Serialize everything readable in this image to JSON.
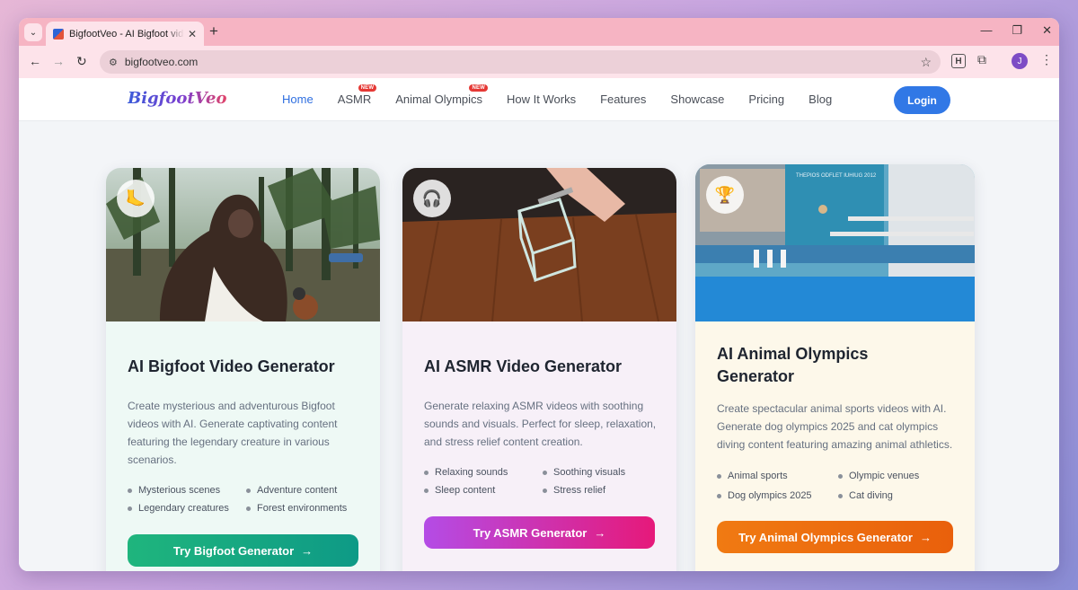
{
  "browser": {
    "tab_title": "BigfootVeo - AI Bigfoot video G",
    "url": "bigfootveo.com",
    "profile_initial": "J",
    "extension_label": "H"
  },
  "site": {
    "logo": "BigfootVeo",
    "nav": [
      {
        "label": "Home",
        "active": true
      },
      {
        "label": "ASMR",
        "badge": "NEW"
      },
      {
        "label": "Animal Olympics",
        "badge": "NEW"
      },
      {
        "label": "How It Works"
      },
      {
        "label": "Features"
      },
      {
        "label": "Showcase"
      },
      {
        "label": "Pricing"
      },
      {
        "label": "Blog"
      }
    ],
    "login_label": "Login"
  },
  "cards": [
    {
      "icon": "🦶",
      "title": "AI Bigfoot Video Generator",
      "description": "Create mysterious and adventurous Bigfoot videos with AI. Generate captivating content featuring the legendary creature in various scenarios.",
      "features": [
        "Mysterious scenes",
        "Adventure content",
        "Legendary creatures",
        "Forest environments"
      ],
      "cta": "Try Bigfoot Generator",
      "cta_colors": [
        "#1fb57d",
        "#0e9a86"
      ]
    },
    {
      "icon": "🎧",
      "title": "AI ASMR Video Generator",
      "description": "Generate relaxing ASMR videos with soothing sounds and visuals. Perfect for sleep, relaxation, and stress relief content creation.",
      "features": [
        "Relaxing sounds",
        "Soothing visuals",
        "Sleep content",
        "Stress relief"
      ],
      "cta": "Try ASMR Generator",
      "cta_colors": [
        "#b44ce6",
        "#e6197a"
      ]
    },
    {
      "icon": "🏆",
      "title": "AI Animal Olympics Generator",
      "description": "Create spectacular animal sports videos with AI. Generate dog olympics 2025 and cat olympics diving content featuring amazing animal athletics.",
      "features": [
        "Animal sports",
        "Olympic venues",
        "Dog olympics 2025",
        "Cat diving"
      ],
      "cta": "Try Animal Olympics Generator",
      "cta_colors": [
        "#f07a12",
        "#e9600c"
      ],
      "image_caption": "THEPIOS ODFLET IUHIUG 2012"
    }
  ]
}
